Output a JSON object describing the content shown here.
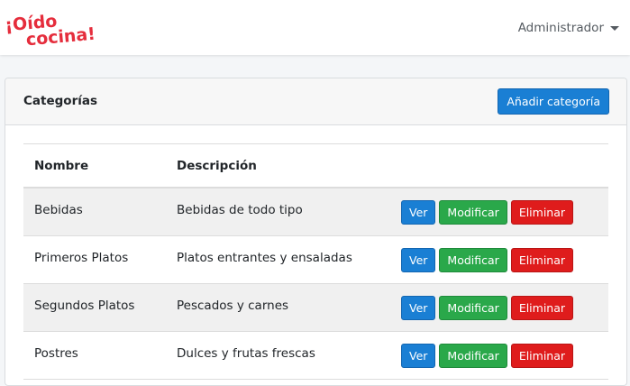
{
  "navbar": {
    "logo_text": "¡Oído cocina!",
    "user_label": "Administrador"
  },
  "card": {
    "title": "Categorías",
    "add_button": "Añadir categoría"
  },
  "table": {
    "headers": [
      "Nombre",
      "Descripción"
    ],
    "rows": [
      {
        "name": "Bebidas",
        "description": "Bebidas de todo tipo"
      },
      {
        "name": "Primeros Platos",
        "description": "Platos entrantes y ensaladas"
      },
      {
        "name": "Segundos Platos",
        "description": "Pescados y carnes"
      },
      {
        "name": "Postres",
        "description": "Dulces y frutas frescas"
      }
    ],
    "actions": {
      "view": "Ver",
      "edit": "Modificar",
      "delete": "Eliminar"
    }
  },
  "colors": {
    "brand": "#e52d3c",
    "primary": "#1a7fd4",
    "success": "#2aa84a",
    "danger": "#df1c1c"
  }
}
